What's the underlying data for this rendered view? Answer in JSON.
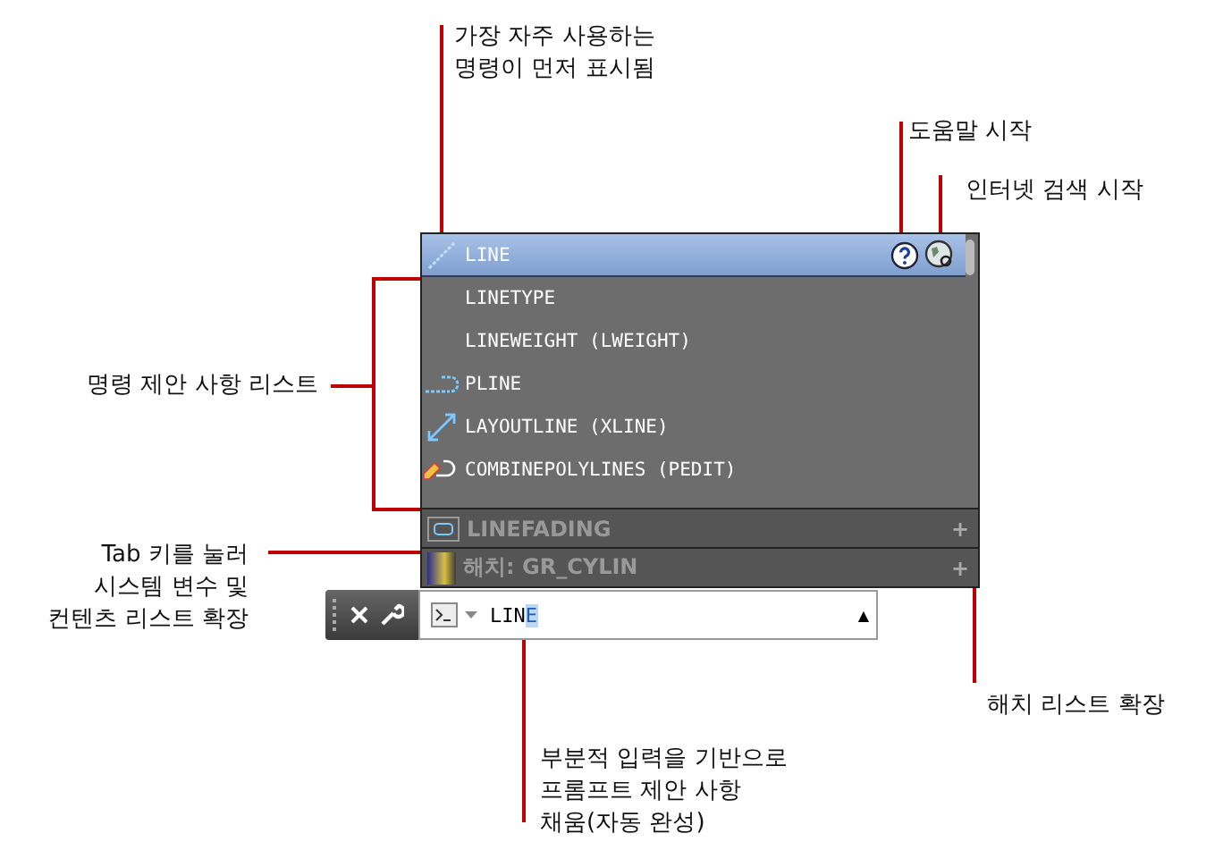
{
  "annotations": [
    {
      "kind": "top",
      "text": "가장 자주 사용하는\n명령이 먼저 표시됨"
    },
    {
      "kind": "help",
      "text": "도움말 시작"
    },
    {
      "kind": "internet",
      "text": "인터넷 검색 시작"
    },
    {
      "kind": "list",
      "text": "명령 제안 사항 리스트"
    },
    {
      "kind": "tab",
      "text": "Tab 키를 눌러\n시스템 변수 및\n컨텐츠 리스트 확장"
    },
    {
      "kind": "hatch",
      "text": "해치 리스트 확장"
    },
    {
      "kind": "autocomplete",
      "text": "부분적 입력을 기반으로\n프롬프트 제안 사항\n채움(자동 완성)"
    }
  ],
  "suggestions": [
    {
      "label": "LINE",
      "kind": "line",
      "selected": true
    },
    {
      "label": "LINETYPE",
      "kind": "plain",
      "selected": false
    },
    {
      "label": "LINEWEIGHT (LWEIGHT)",
      "kind": "plain",
      "selected": false
    },
    {
      "label": "PLINE",
      "kind": "polyline",
      "selected": false
    },
    {
      "label": "LAYOUTLINE (XLINE)",
      "kind": "construction",
      "selected": false
    },
    {
      "label": "COMBINEPOLYLINES (PEDIT)",
      "kind": "edit",
      "selected": false
    }
  ],
  "categories": [
    {
      "kind": "sysvar",
      "label": "LINEFADING",
      "expand": "+"
    },
    {
      "kind": "hatch",
      "label": "해치: GR_CYLIN",
      "expand": "+"
    }
  ],
  "command_line": {
    "typed": "LIN",
    "completion": "E",
    "history_arrow": "▲"
  }
}
